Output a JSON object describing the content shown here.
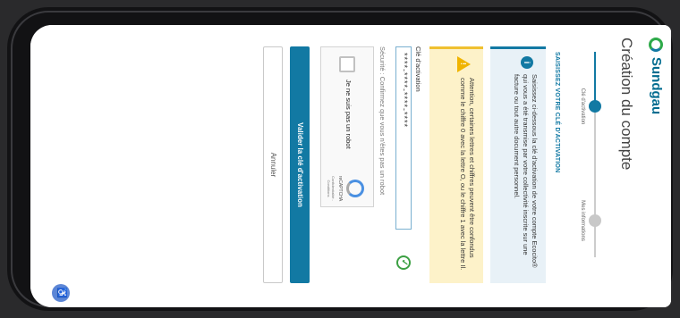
{
  "brand": {
    "name": "Sundgau",
    "logo_icon": "sundgau-logo-icon",
    "colors": {
      "primary": "#1279a3",
      "green": "#2eaa4a"
    }
  },
  "page": {
    "title": "Création du compte"
  },
  "steps": [
    {
      "label": "Clé d'activation",
      "active": true
    },
    {
      "label": "Mes informations",
      "active": false
    }
  ],
  "section_title": "SAISISSEZ VOTRE CLÉ D'ACTIVATION",
  "info_box": {
    "icon": "info-icon",
    "text": "Saisissez ci-dessous la clé d'activation de votre compte Ecocito® qui vous a été transmise par votre collectivité inscrite sur une facture ou tout autre document personnel."
  },
  "warning_box": {
    "icon": "warning-icon",
    "text": "Attention, certaines lettres et chiffres peuvent être confondus comme le chiffre 0 avec la lettre O, ou le chiffre 1 avec la lettre Il."
  },
  "key_field": {
    "label": "Clé d'activation",
    "value": "****-****-****-****",
    "valid_icon": "check-circle-icon"
  },
  "security_text": "Sécurité : Confirmez que vous n'êtes pas un robot",
  "captcha": {
    "label": "Je ne suis pas un robot",
    "brand": "reCAPTCHA",
    "links": "Confidentialité - Conditions"
  },
  "buttons": {
    "submit": "Valider la clé d'activation",
    "cancel": "Annuler"
  },
  "floating_button": {
    "icon": "accessibility-icon"
  }
}
